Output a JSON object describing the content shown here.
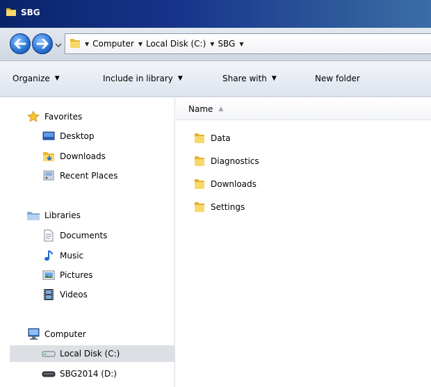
{
  "window": {
    "title": "SBG",
    "accent": "#0a246a"
  },
  "address": {
    "crumbs": [
      {
        "label": "Computer"
      },
      {
        "label": "Local Disk (C:)"
      },
      {
        "label": "SBG"
      }
    ]
  },
  "toolbar": {
    "organize": "Organize",
    "include_in_library": "Include in library",
    "share_with": "Share with",
    "new_folder": "New folder"
  },
  "nav": {
    "favorites": {
      "label": "Favorites",
      "items": [
        "Desktop",
        "Downloads",
        "Recent Places"
      ]
    },
    "libraries": {
      "label": "Libraries",
      "items": [
        "Documents",
        "Music",
        "Pictures",
        "Videos"
      ]
    },
    "computer": {
      "label": "Computer",
      "items": [
        "Local Disk (C:)",
        "SBG2014 (D:)"
      ],
      "selected": "Local Disk (C:)"
    }
  },
  "content": {
    "column_name": "Name",
    "items": [
      "Data",
      "Diagnostics",
      "Downloads",
      "Settings"
    ]
  }
}
